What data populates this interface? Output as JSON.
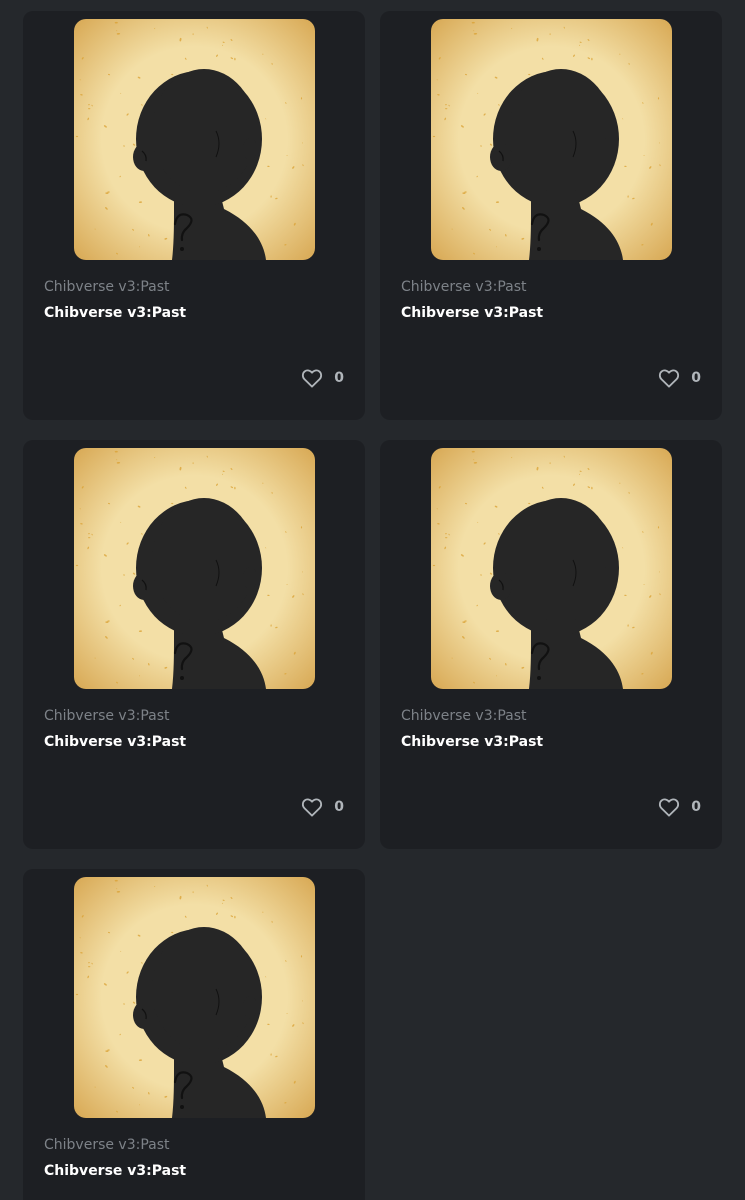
{
  "colors": {
    "page_bg": "#25282c",
    "card_bg": "#1d1f23",
    "collection_text": "#7d8288",
    "title_text": "#ffffff",
    "like_text": "#b0b5ba",
    "art_bg": "#f3dfa6",
    "silhouette": "#262626"
  },
  "icons": {
    "like": "heart-outline-icon"
  },
  "items": [
    {
      "collection": "Chibverse v3:Past",
      "title": "Chibverse v3:Past",
      "likes": "0"
    },
    {
      "collection": "Chibverse v3:Past",
      "title": "Chibverse v3:Past",
      "likes": "0"
    },
    {
      "collection": "Chibverse v3:Past",
      "title": "Chibverse v3:Past",
      "likes": "0"
    },
    {
      "collection": "Chibverse v3:Past",
      "title": "Chibverse v3:Past",
      "likes": "0"
    },
    {
      "collection": "Chibverse v3:Past",
      "title": "Chibverse v3:Past"
    }
  ]
}
